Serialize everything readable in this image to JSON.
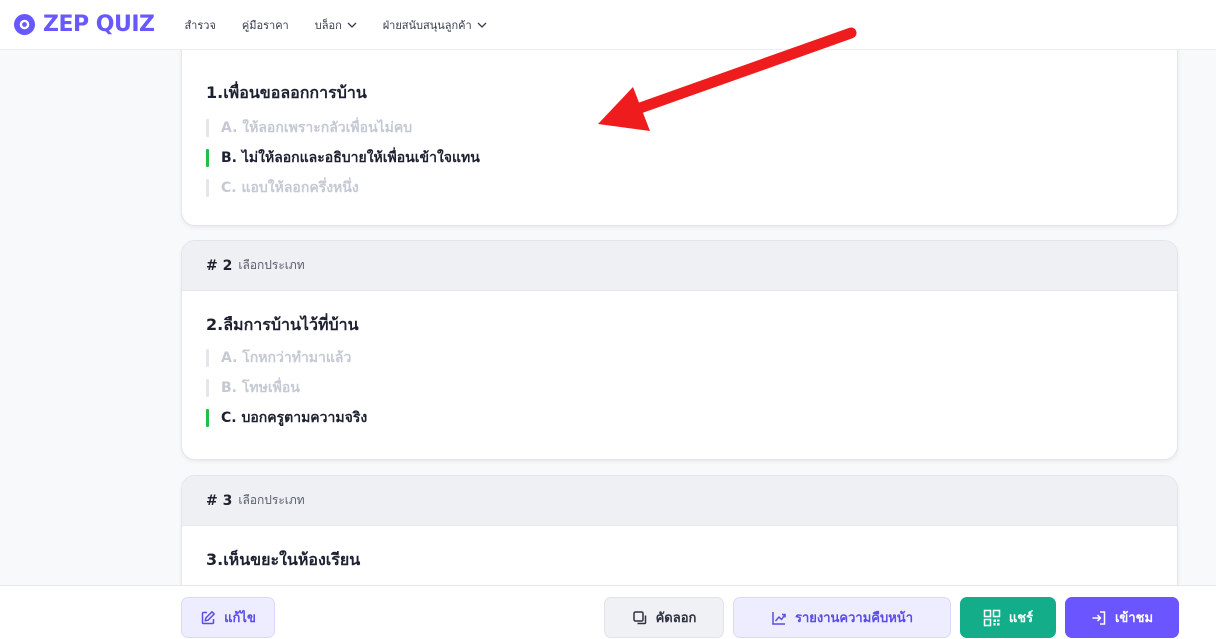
{
  "brand": {
    "name": "ZEP QUIZ",
    "color": "#6758ff"
  },
  "nav": {
    "items": [
      {
        "label": "สำรวจ",
        "dropdown": false
      },
      {
        "label": "คู่มือราคา",
        "dropdown": false
      },
      {
        "label": "บล็อก",
        "dropdown": true
      },
      {
        "label": "ฝ่ายสนับสนุนลูกค้า",
        "dropdown": true
      }
    ]
  },
  "questions": [
    {
      "number": "",
      "type": "",
      "title": "1.เพื่อนขอลอกการบ้าน",
      "options": [
        {
          "text": "A. ให้ลอกเพราะกลัวเพื่อนไม่คบ",
          "correct": false
        },
        {
          "text": "B. ไม่ให้ลอกและอธิบายให้เพื่อนเข้าใจแทน",
          "correct": true
        },
        {
          "text": "C. แอบให้ลอกครึ่งหนึ่ง",
          "correct": false
        }
      ]
    },
    {
      "number": "# 2",
      "type": "เลือกประเภท",
      "title": "2.ลืมการบ้านไว้ที่บ้าน",
      "options": [
        {
          "text": "A. โกหกว่าทำมาแล้ว",
          "correct": false
        },
        {
          "text": "B. โทษเพื่อน",
          "correct": false
        },
        {
          "text": "C. บอกครูตามความจริง",
          "correct": true
        }
      ]
    },
    {
      "number": "# 3",
      "type": "เลือกประเภท",
      "title": "3.เห็นขยะในห้องเรียน",
      "options": []
    }
  ],
  "toolbar": {
    "edit_label": "แก้ไข",
    "copy_label": "คัดลอก",
    "report_label": "รายงานความคืบหน้า",
    "share_label": "แชร์",
    "enter_label": "เข้าชม"
  },
  "colors": {
    "accent": "#6758ff",
    "correct": "#1fbf4a",
    "share": "#14ad8a",
    "annotation_arrow": "#ee1c1c"
  },
  "icons": [
    "zep-logo-icon",
    "chevron-down-icon",
    "edit-icon",
    "copy-icon",
    "chart-icon",
    "qr-icon",
    "enter-icon",
    "red-arrow-annotation"
  ]
}
